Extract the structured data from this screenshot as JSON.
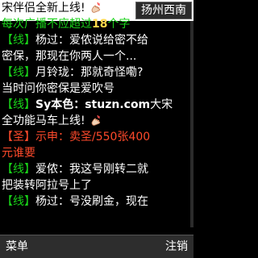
{
  "header": {
    "location": "扬州西南"
  },
  "chat_lines": [
    {
      "segments": [
        {
          "text": "宋伴侣全新上线!",
          "color": "black"
        }
      ],
      "icon": "hand-icon"
    },
    {
      "segments": [
        {
          "text": "每次广播不应超过",
          "color": "green"
        },
        {
          "text": "18",
          "color": "yellow",
          "bold": true
        },
        {
          "text": "个字",
          "color": "green"
        }
      ]
    },
    {
      "segments": [
        {
          "text": "【线】",
          "color": "green"
        },
        {
          "text": "杨过：爱侬说给密不给",
          "color": "white"
        }
      ]
    },
    {
      "segments": [
        {
          "text": "密保，那现在你两人一个...",
          "color": "white"
        }
      ]
    },
    {
      "segments": [
        {
          "text": "【线】",
          "color": "green"
        },
        {
          "text": "月铃珑：那就奇怪嘞?",
          "color": "white"
        }
      ]
    },
    {
      "segments": [
        {
          "text": "当时问你密保是爱吹号",
          "color": "white"
        }
      ]
    },
    {
      "segments": [
        {
          "text": "【线】",
          "color": "green"
        },
        {
          "text": "Sy本色：",
          "color": "white",
          "bold": true
        },
        {
          "text": "stuzn.com",
          "color": "white",
          "bold": true
        },
        {
          "text": "大宋",
          "color": "white"
        }
      ]
    },
    {
      "segments": [
        {
          "text": "全功能马车上线!",
          "color": "white"
        }
      ],
      "icon": "hand-icon"
    },
    {
      "segments": [
        {
          "text": "【圣】",
          "color": "red"
        },
        {
          "text": "示申：卖圣/550张400",
          "color": "red"
        }
      ]
    },
    {
      "segments": [
        {
          "text": "元谁要",
          "color": "red"
        }
      ]
    },
    {
      "segments": [
        {
          "text": "【线】",
          "color": "green"
        },
        {
          "text": "爱侬：我这号刚转二就",
          "color": "white"
        }
      ]
    },
    {
      "segments": [
        {
          "text": "把装转阿拉号上了",
          "color": "white"
        }
      ]
    },
    {
      "segments": [
        {
          "text": "【线】",
          "color": "green"
        },
        {
          "text": "杨过：号没刷金，现在",
          "color": "white"
        }
      ]
    }
  ],
  "softkeys": {
    "left": "菜单",
    "right": "注销"
  }
}
